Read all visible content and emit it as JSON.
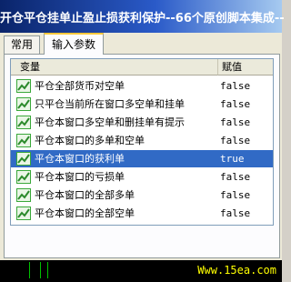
{
  "window": {
    "title": "开仓平仓挂单止盈止损获利保护--66个原创脚本集成--"
  },
  "tabs": [
    {
      "label": "常用"
    },
    {
      "label": "输入参数"
    }
  ],
  "table": {
    "headers": {
      "variable": "变量",
      "value": "赋值"
    },
    "rows": [
      {
        "name": "平仓全部货币对空单",
        "value": "false"
      },
      {
        "name": "只平仓当前所在窗口多空单和挂单",
        "value": "false"
      },
      {
        "name": "平仓本窗口多空单和删挂单有提示",
        "value": "false"
      },
      {
        "name": "平仓本窗口的多单和空单",
        "value": "false"
      },
      {
        "name": "平仓本窗口的获利单",
        "value": "true",
        "selected": true
      },
      {
        "name": "平仓本窗口的亏损单",
        "value": "false"
      },
      {
        "name": "平仓本窗口的全部多单",
        "value": "false"
      },
      {
        "name": "平仓本窗口的全部空单",
        "value": "false"
      }
    ]
  },
  "status": {
    "watermark": "Www.15ea.com"
  },
  "colors": {
    "selection": "#316ac5",
    "icon_green": "#3aa83a",
    "title_bar": "#0a246a"
  },
  "icons": {
    "row_icon": "parameter-chart-icon"
  }
}
